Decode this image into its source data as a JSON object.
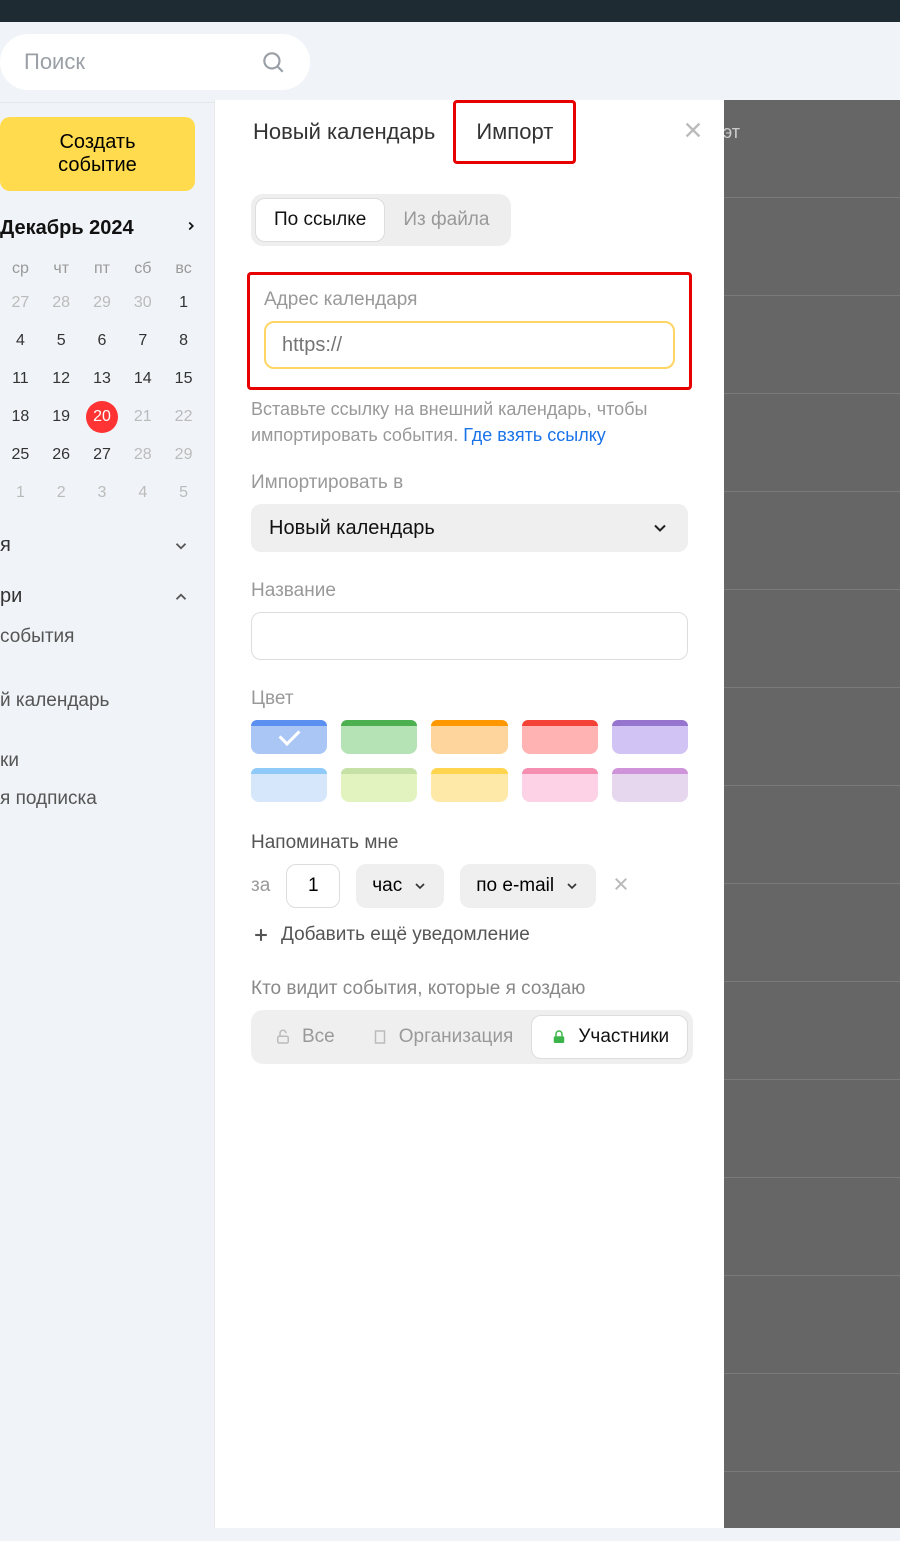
{
  "search": {
    "placeholder": "Поиск"
  },
  "sidebar": {
    "create": "Создать событие",
    "month": "Декабрь 2024",
    "dow": [
      "ср",
      "чт",
      "пт",
      "сб",
      "вс"
    ],
    "weeks": [
      [
        {
          "d": "27",
          "m": true
        },
        {
          "d": "28",
          "m": true
        },
        {
          "d": "29",
          "m": true
        },
        {
          "d": "30",
          "m": true
        },
        {
          "d": "1",
          "m": false
        }
      ],
      [
        {
          "d": "4",
          "m": false
        },
        {
          "d": "5",
          "m": false
        },
        {
          "d": "6",
          "m": false
        },
        {
          "d": "7",
          "m": false
        },
        {
          "d": "8",
          "m": false
        }
      ],
      [
        {
          "d": "11",
          "m": false
        },
        {
          "d": "12",
          "m": false
        },
        {
          "d": "13",
          "m": false
        },
        {
          "d": "14",
          "m": false
        },
        {
          "d": "15",
          "m": false
        }
      ],
      [
        {
          "d": "18",
          "m": false
        },
        {
          "d": "19",
          "m": false
        },
        {
          "d": "20",
          "m": false,
          "today": true
        },
        {
          "d": "21",
          "m": true
        },
        {
          "d": "22",
          "m": true
        }
      ],
      [
        {
          "d": "25",
          "m": false
        },
        {
          "d": "26",
          "m": false
        },
        {
          "d": "27",
          "m": false
        },
        {
          "d": "28",
          "m": true
        },
        {
          "d": "29",
          "m": true
        }
      ],
      [
        {
          "d": "1",
          "m": true
        },
        {
          "d": "2",
          "m": true
        },
        {
          "d": "3",
          "m": true
        },
        {
          "d": "4",
          "m": true
        },
        {
          "d": "5",
          "m": true
        }
      ]
    ],
    "section1_label": "я",
    "section2_label": "ри",
    "items": [
      "события",
      "й календарь",
      "ки",
      "я подписка"
    ]
  },
  "panel": {
    "tab_new": "Новый календарь",
    "tab_import": "Импорт",
    "seg_link": "По ссылке",
    "seg_file": "Из файла",
    "url_label": "Адрес календаря",
    "url_placeholder": "https://",
    "hint_pre": "Вставьте ссылку на внешний календарь, чтобы импортировать события. ",
    "hint_link": "Где взять ссылку",
    "import_to_label": "Импортировать в",
    "import_to_value": "Новый календарь",
    "name_label": "Название",
    "color_label": "Цвет",
    "colors_row1": [
      {
        "body": "#a9c6f4",
        "strip": "#5b8ff0",
        "sel": true
      },
      {
        "body": "#b6e3b6",
        "strip": "#4caf50"
      },
      {
        "body": "#ffd59e",
        "strip": "#ff9800"
      },
      {
        "body": "#ffb3b3",
        "strip": "#f44336"
      },
      {
        "body": "#d1c4f5",
        "strip": "#9575cd"
      }
    ],
    "colors_row2": [
      {
        "body": "#d6e7fb",
        "strip": "#90caf9"
      },
      {
        "body": "#e3f3c0",
        "strip": "#c5e1a5"
      },
      {
        "body": "#ffe9a8",
        "strip": "#ffd54f"
      },
      {
        "body": "#fdd2e6",
        "strip": "#f48fb1"
      },
      {
        "body": "#e6d7ef",
        "strip": "#ce93d8"
      }
    ],
    "remind_label": "Напоминать мне",
    "remind_prefix": "за",
    "remind_value": "1",
    "remind_unit": "час",
    "remind_channel": "по e-mail",
    "add_remind": "Добавить ещё уведомление",
    "vis_label": "Кто видит события, которые я создаю",
    "vis_all": "Все",
    "vis_org": "Организация",
    "vis_part": "Участники"
  },
  "back_label": "эт"
}
